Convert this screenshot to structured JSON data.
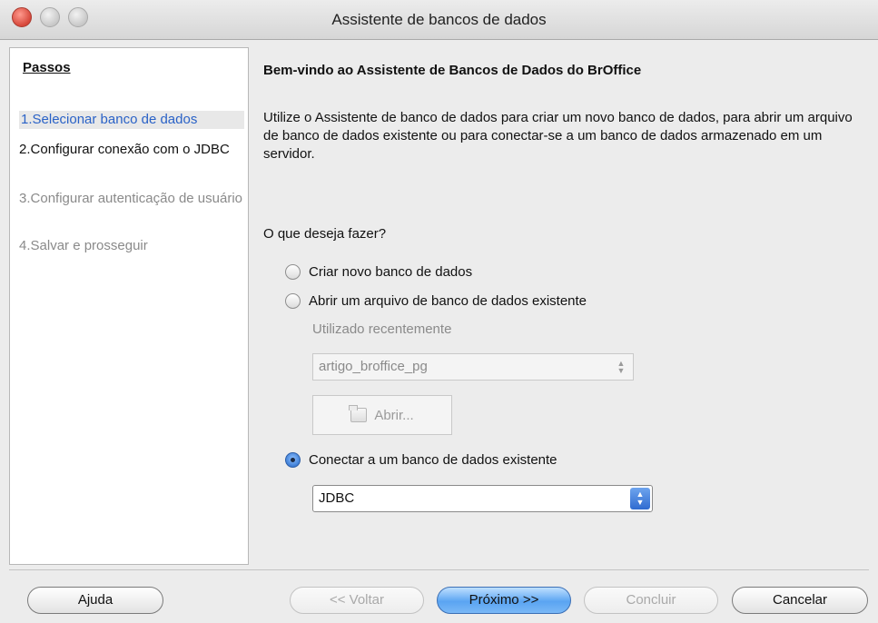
{
  "window": {
    "title": "Assistente de bancos de dados"
  },
  "sidebar": {
    "heading": "Passos",
    "steps": [
      {
        "number": "1.",
        "label": "Selecionar banco de dados",
        "state": "current"
      },
      {
        "number": "2.",
        "label": "Configurar conexão com o JDBC",
        "state": "enabled"
      },
      {
        "number": "3.",
        "label": "Configurar autenticação de usuário",
        "state": "disabled"
      },
      {
        "number": "4.",
        "label": "Salvar e prosseguir",
        "state": "disabled"
      }
    ]
  },
  "main": {
    "heading": "Bem-vindo ao Assistente de Bancos de Dados do BrOffice",
    "intro": "Utilize o Assistente de banco de dados para criar um novo banco de dados, para abrir um arquivo de banco de dados existente ou para conectar-se a um banco de dados armazenado em um servidor.",
    "question": "O que deseja fazer?",
    "options": [
      {
        "label": "Criar novo banco de dados",
        "checked": false
      },
      {
        "label": "Abrir um arquivo de banco de dados existente",
        "checked": false
      },
      {
        "label": "Conectar a um banco de dados existente",
        "checked": true
      }
    ],
    "recent_label": "Utilizado recentemente",
    "recent_value": "artigo_broffice_pg",
    "open_button": "Abrir...",
    "connection_type": "JDBC"
  },
  "buttons": {
    "help": "Ajuda",
    "back": "<< Voltar",
    "next": "Próximo >>",
    "finish": "Concluir",
    "cancel": "Cancelar"
  },
  "icons": {
    "combo_stepper": "up-down-arrows-icon",
    "open_file": "folder-icon"
  },
  "colors": {
    "accent": "#3f7fd6",
    "current_step": "#2a62c7",
    "disabled_text": "#8a8a8a"
  }
}
